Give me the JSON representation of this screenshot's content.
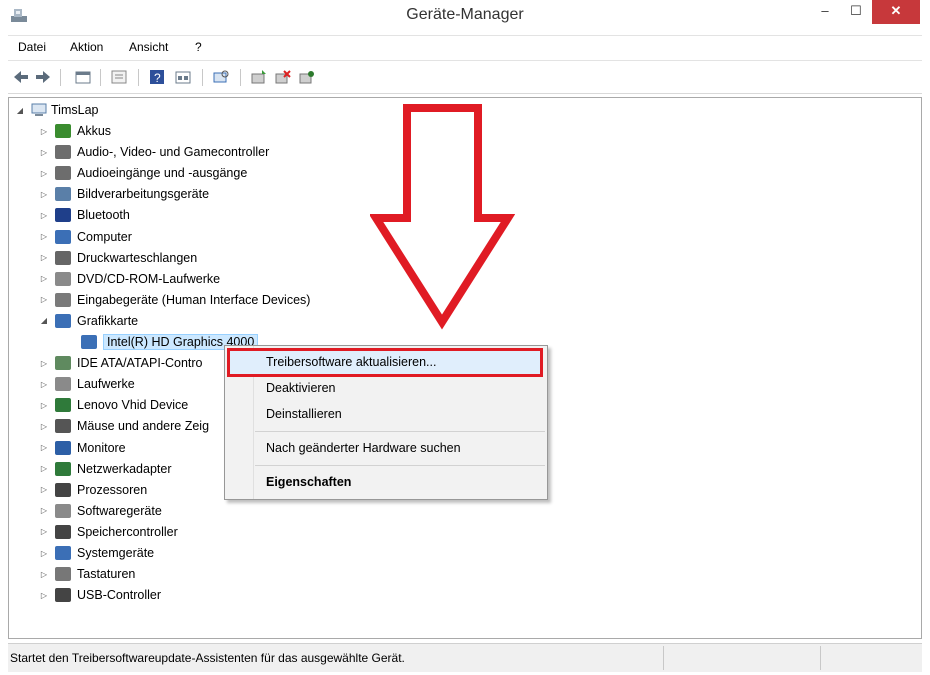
{
  "window": {
    "title": "Geräte-Manager",
    "controls": {
      "minimize": "–",
      "maximize": "☐",
      "close": "✕"
    }
  },
  "menubar": {
    "items": [
      "Datei",
      "Aktion",
      "Ansicht",
      "?"
    ]
  },
  "tree": {
    "root": "TimsLap",
    "items": [
      {
        "label": "Akkus",
        "icon": "battery-icon",
        "color": "#3a8c2f"
      },
      {
        "label": "Audio-, Video- und Gamecontroller",
        "icon": "speaker-icon",
        "color": "#6d6d6d"
      },
      {
        "label": "Audioeingänge und -ausgänge",
        "icon": "speaker-icon",
        "color": "#6d6d6d"
      },
      {
        "label": "Bildverarbeitungsgeräte",
        "icon": "camera-icon",
        "color": "#5a7fa8"
      },
      {
        "label": "Bluetooth",
        "icon": "bluetooth-icon",
        "color": "#1f3f8a"
      },
      {
        "label": "Computer",
        "icon": "computer-icon",
        "color": "#3b6fb6"
      },
      {
        "label": "Druckwarteschlangen",
        "icon": "printer-icon",
        "color": "#666666"
      },
      {
        "label": "DVD/CD-ROM-Laufwerke",
        "icon": "disc-drive-icon",
        "color": "#8a8a8a"
      },
      {
        "label": "Eingabegeräte (Human Interface Devices)",
        "icon": "hid-icon",
        "color": "#7a7a7a"
      },
      {
        "label": "Grafikkarte",
        "icon": "display-adapter-icon",
        "color": "#3b6fb6"
      },
      {
        "label": "IDE ATA/ATAPI-Contro",
        "icon": "ide-controller-icon",
        "color": "#5f8a5f"
      },
      {
        "label": "Laufwerke",
        "icon": "drive-icon",
        "color": "#8a8a8a"
      },
      {
        "label": "Lenovo Vhid Device",
        "icon": "network-icon",
        "color": "#2f7a3a"
      },
      {
        "label": "Mäuse und andere Zeig",
        "icon": "mouse-icon",
        "color": "#555555"
      },
      {
        "label": "Monitore",
        "icon": "monitor-icon",
        "color": "#2d5fa6"
      },
      {
        "label": "Netzwerkadapter",
        "icon": "network-icon",
        "color": "#2f7a3a"
      },
      {
        "label": "Prozessoren",
        "icon": "processor-icon",
        "color": "#444444"
      },
      {
        "label": "Softwaregeräte",
        "icon": "software-device-icon",
        "color": "#8a8a8a"
      },
      {
        "label": "Speichercontroller",
        "icon": "storage-controller-icon",
        "color": "#444444"
      },
      {
        "label": "Systemgeräte",
        "icon": "system-device-icon",
        "color": "#3b6fb6"
      },
      {
        "label": "Tastaturen",
        "icon": "keyboard-icon",
        "color": "#777777"
      },
      {
        "label": "USB-Controller",
        "icon": "usb-icon",
        "color": "#444444"
      }
    ],
    "child": "Intel(R) HD Graphics 4000"
  },
  "context_menu": {
    "items": [
      "Treibersoftware aktualisieren...",
      "Deaktivieren",
      "Deinstallieren",
      "Nach geänderter Hardware suchen",
      "Eigenschaften"
    ]
  },
  "status": {
    "text": "Startet den Treibersoftwareupdate-Assistenten für das ausgewählte Gerät."
  },
  "colors": {
    "highlight_red": "#e01b24",
    "close_button": "#c7383b",
    "selection": "#cce8ff"
  }
}
